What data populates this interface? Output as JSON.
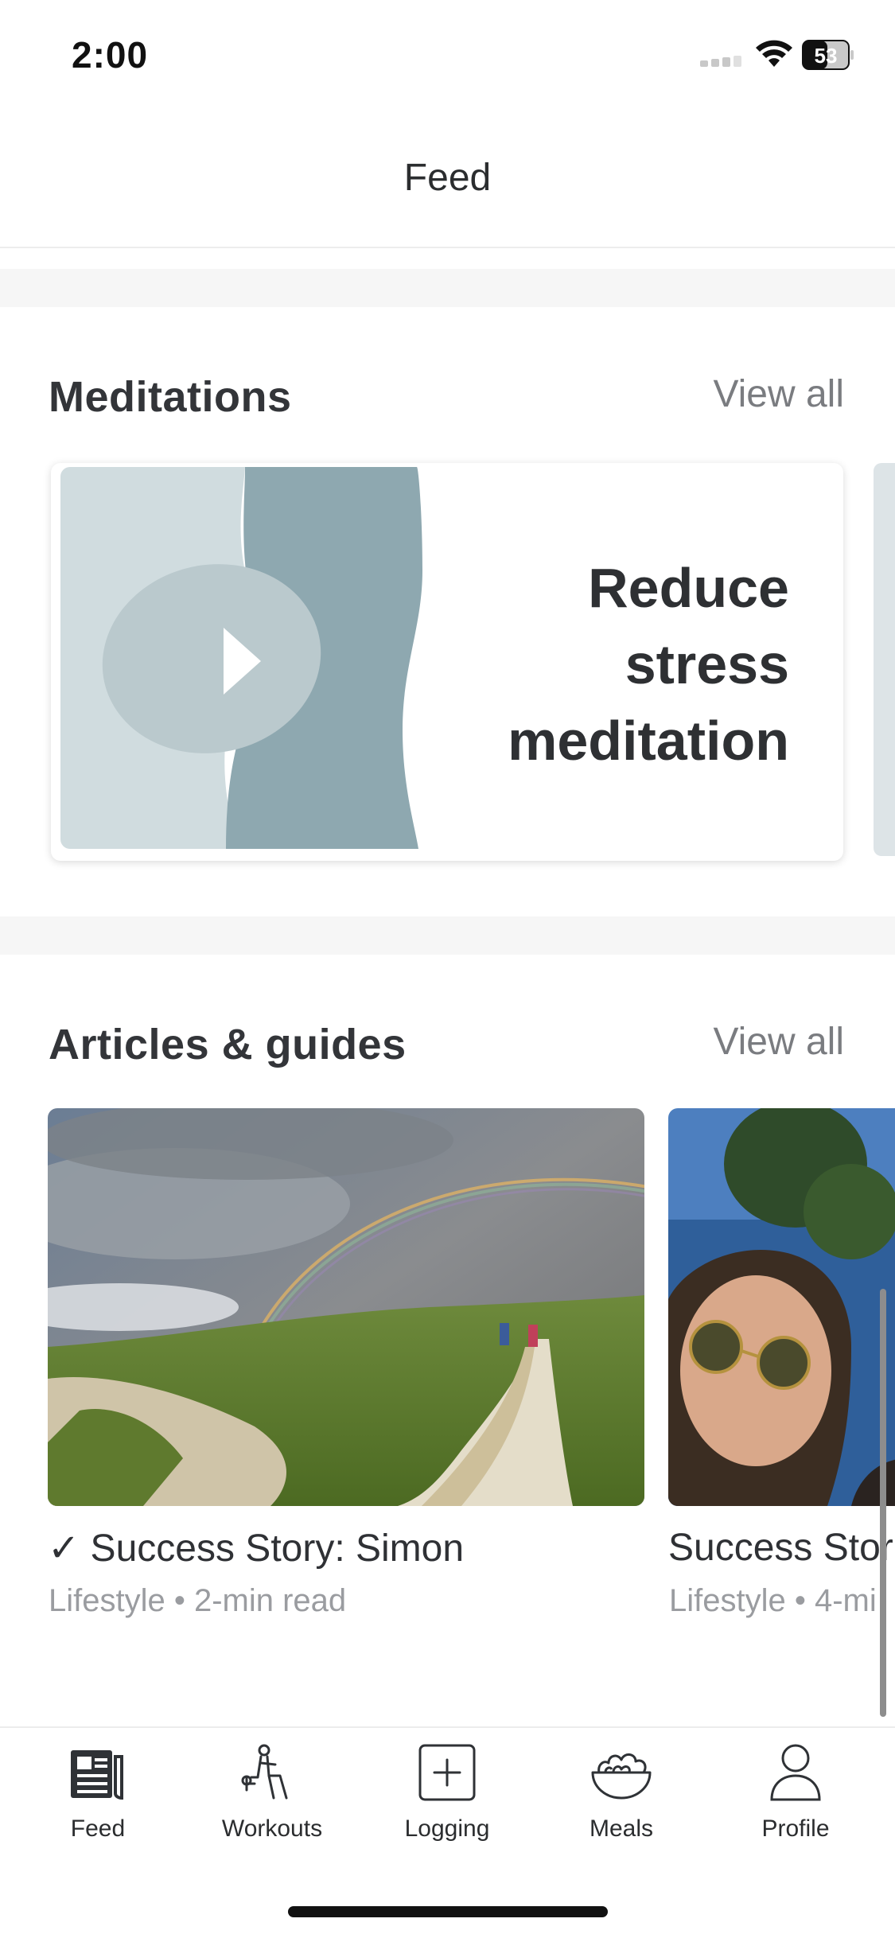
{
  "status_bar": {
    "time": "2:00",
    "battery": "53"
  },
  "header": {
    "title": "Feed"
  },
  "meditations": {
    "title": "Meditations",
    "view_all": "View all",
    "card": {
      "line1": "Reduce",
      "line2": "stress",
      "line3": "meditation"
    }
  },
  "articles": {
    "title": "Articles & guides",
    "view_all": "View all",
    "items": [
      {
        "title": "✓ Success Story: Simon",
        "meta": "Lifestyle • 2-min read"
      },
      {
        "title": "Success Stor",
        "meta": "Lifestyle • 4-mi"
      }
    ]
  },
  "tabs": [
    {
      "label": "Feed",
      "icon": "newspaper-icon",
      "active": true
    },
    {
      "label": "Workouts",
      "icon": "workout-figure-icon"
    },
    {
      "label": "Logging",
      "icon": "plus-square-icon"
    },
    {
      "label": "Meals",
      "icon": "salad-bowl-icon"
    },
    {
      "label": "Profile",
      "icon": "person-icon"
    }
  ]
}
